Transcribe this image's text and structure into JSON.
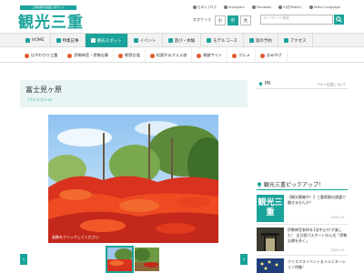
{
  "header": {
    "tagline": "三重県観光連盟公式サイト",
    "logo": "観光三重",
    "links": [
      {
        "label": "日本人ブログ",
        "icon": "globe-icon"
      },
      {
        "label": "Instagram",
        "icon": "instagram-icon"
      },
      {
        "label": "Facebook",
        "icon": "facebook-icon"
      },
      {
        "label": "X(旧Twitter)",
        "icon": "x-icon"
      },
      {
        "label": "Select Language",
        "icon": "language-icon"
      }
    ],
    "font_size_label": "文字サイズ",
    "font_sizes": [
      "小",
      "中",
      "大"
    ],
    "search_placeholder": "キーワード検索"
  },
  "nav_main": [
    {
      "label": "HOME"
    },
    {
      "label": "特集記事"
    },
    {
      "label": "観光スポット"
    },
    {
      "label": "イベント"
    },
    {
      "label": "遊び・体験"
    },
    {
      "label": "モデルコース"
    },
    {
      "label": "旅の予約"
    },
    {
      "label": "アクセス"
    }
  ],
  "nav_sub": [
    {
      "label": "はやわかり三重"
    },
    {
      "label": "伊勢神宮・伊勢志摩"
    },
    {
      "label": "熊野古道"
    },
    {
      "label": "松阪牛＆グルメ旅"
    },
    {
      "label": "桐旅サイト"
    },
    {
      "label": "グルメ"
    },
    {
      "label": "おみやげ"
    }
  ],
  "spot": {
    "title": "富士見ヶ原",
    "reading": "（フジミガハラ）",
    "photo_caption": "画像をクリックしてください"
  },
  "pr": {
    "label": "PR",
    "note": "バナー広告について"
  },
  "pickup": {
    "title": "観光三重ピックアップ！",
    "logo_text": "観光三重",
    "items": [
      {
        "text": "【観光募集中！】三重県観光連盟で働きませんか？",
        "date": "2022.10"
      },
      {
        "text": "伊勢神宮参拝を1泊中止/けず楽しむ！ 全日程パスポートの公式「伊勢志摩を多く」",
        "date": "2022.10"
      },
      {
        "text": "クリスマスイベント＆イルミネーション特集！",
        "date": ""
      }
    ]
  },
  "colors": {
    "accent": "#1aa39a"
  }
}
